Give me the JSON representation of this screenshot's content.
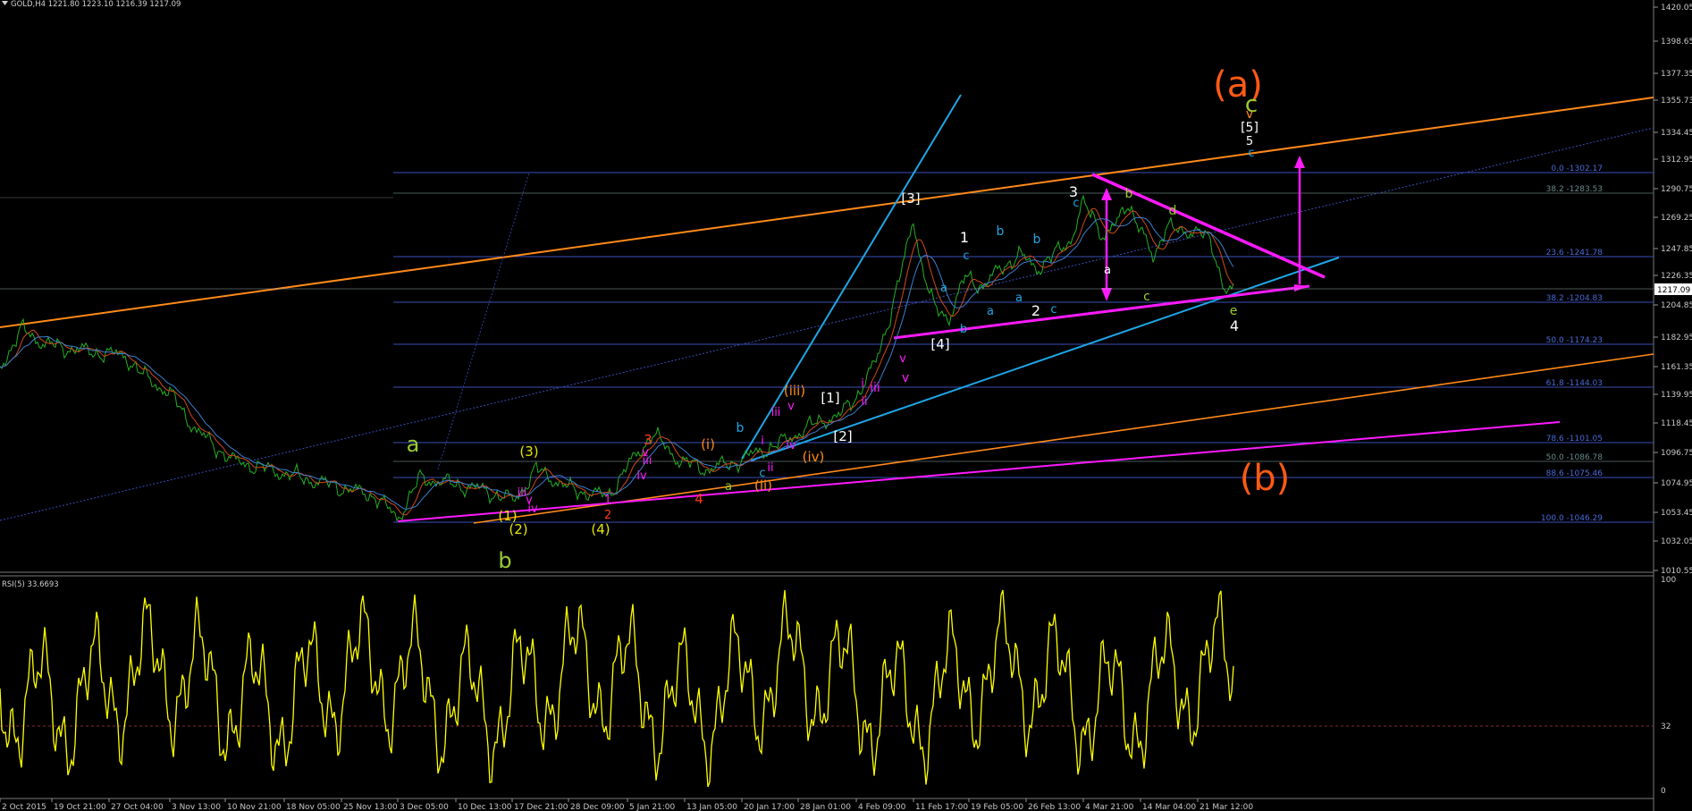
{
  "header": {
    "symbol_line": "GOLD,H4  1221.80 1223.10 1216.39 1217.09",
    "rsi_label": "RSI(5) 33.6693"
  },
  "colors": {
    "background": "#000000",
    "price": "#22b022",
    "ma_fast": "#d04a1a",
    "ma_slow": "#3a7fd0",
    "rsi": "#ffff00",
    "orange_channel": "#ff8a1a",
    "magenta": "#ff1aff",
    "cyan_trend": "#1fa6e6",
    "fib_line": "#3a4fb8"
  },
  "price_axis": {
    "ticks": [
      "1420.05",
      "1398.65",
      "1377.35",
      "1355.73",
      "1334.45",
      "1312.95",
      "1290.75",
      "1269.25",
      "1247.85",
      "1226.35",
      "1204.85",
      "1182.95",
      "1161.35",
      "1139.95",
      "1118.45",
      "1096.75",
      "1074.95",
      "1053.45",
      "1032.05",
      "1010.55"
    ],
    "current_price": "1217.09"
  },
  "rsi_axis": {
    "ticks": [
      "100",
      "32",
      "0"
    ]
  },
  "time_axis": {
    "ticks": [
      "2 Oct 2015",
      "19 Oct 21:00",
      "27 Oct 04:00",
      "3 Nov 13:00",
      "10 Nov 21:00",
      "18 Nov 05:00",
      "25 Nov 13:00",
      "3 Dec 05:00",
      "10 Dec 13:00",
      "17 Dec 21:00",
      "28 Dec 09:00",
      "5 Jan 21:00",
      "13 Jan 05:00",
      "20 Jan 17:00",
      "28 Jan 01:00",
      "4 Feb 09:00",
      "11 Feb 17:00",
      "19 Feb 05:00",
      "26 Feb 13:00",
      "4 Mar 21:00",
      "14 Mar 04:00",
      "21 Mar 12:00"
    ]
  },
  "fib_levels": [
    {
      "label": "0.0 -1302.17"
    },
    {
      "label": "38.2 -1283.53"
    },
    {
      "label": "23.6 -1241.78"
    },
    {
      "label": "38.2 -1204.83"
    },
    {
      "label": "50.0 -1174.23"
    },
    {
      "label": "61.8 -1144.03"
    },
    {
      "label": "78.6 -1101.05"
    },
    {
      "label": "50.0 -1086.78"
    },
    {
      "label": "88.6 -1075.46"
    },
    {
      "label": "100.0 -1046.29"
    }
  ],
  "wave_labels": [
    {
      "text": "(a)",
      "color": "#ff5a14",
      "size": 40
    },
    {
      "text": "c",
      "color": "#9acd32",
      "size": 26
    },
    {
      "text": "v",
      "color": "#ff8a1a",
      "size": 14
    },
    {
      "text": "[5]",
      "color": "#ffffff",
      "size": 14
    },
    {
      "text": "5",
      "color": "#ffffff",
      "size": 13
    },
    {
      "text": "c",
      "color": "#1fa6e6",
      "size": 13
    },
    {
      "text": "(b)",
      "color": "#ff5a14",
      "size": 40
    },
    {
      "text": "a",
      "color": "#9acd32",
      "size": 24
    },
    {
      "text": "b",
      "color": "#9acd32",
      "size": 24
    },
    {
      "text": "(3)",
      "color": "#e6e600",
      "size": 15
    },
    {
      "text": "(1)",
      "color": "#e6e600",
      "size": 15
    },
    {
      "text": "(2)",
      "color": "#e6e600",
      "size": 15
    },
    {
      "text": "(4)",
      "color": "#e6e600",
      "size": 15
    },
    {
      "text": "iii",
      "color": "#ff1aff",
      "size": 13
    },
    {
      "text": "iv",
      "color": "#ff1aff",
      "size": 13
    },
    {
      "text": "v",
      "color": "#ff1aff",
      "size": 13
    },
    {
      "text": "1",
      "color": "#ff1aff",
      "size": 13
    },
    {
      "text": "2",
      "color": "#ff3a1a",
      "size": 13
    },
    {
      "text": "3",
      "color": "#ff3a1a",
      "size": 15
    },
    {
      "text": "4",
      "color": "#ff3a1a",
      "size": 15
    },
    {
      "text": "iii",
      "color": "#ff1aff",
      "size": 13
    },
    {
      "text": "iv",
      "color": "#ff1aff",
      "size": 13
    },
    {
      "text": "v",
      "color": "#ff1aff",
      "size": 13
    },
    {
      "text": "(i)",
      "color": "#ff8a1a",
      "size": 15
    },
    {
      "text": "(ii)",
      "color": "#ff8a1a",
      "size": 15
    },
    {
      "text": "(iii)",
      "color": "#ff8a1a",
      "size": 15
    },
    {
      "text": "(iv)",
      "color": "#ff8a1a",
      "size": 15
    },
    {
      "text": "a",
      "color": "#9acd32",
      "size": 13
    },
    {
      "text": "b",
      "color": "#1fa6e6",
      "size": 14
    },
    {
      "text": "c",
      "color": "#1fa6e6",
      "size": 13
    },
    {
      "text": "i",
      "color": "#ff1aff",
      "size": 13
    },
    {
      "text": "ii",
      "color": "#ff1aff",
      "size": 13
    },
    {
      "text": "iii",
      "color": "#ff1aff",
      "size": 13
    },
    {
      "text": "iv",
      "color": "#ff1aff",
      "size": 13
    },
    {
      "text": "v",
      "color": "#ff1aff",
      "size": 13
    },
    {
      "text": "[1]",
      "color": "#ffffff",
      "size": 15
    },
    {
      "text": "[2]",
      "color": "#ffffff",
      "size": 15
    },
    {
      "text": "i",
      "color": "#ff1aff",
      "size": 13
    },
    {
      "text": "ii",
      "color": "#ff1aff",
      "size": 13
    },
    {
      "text": "iii",
      "color": "#ff1aff",
      "size": 14
    },
    {
      "text": "v",
      "color": "#ff1aff",
      "size": 14
    },
    {
      "text": "[3]",
      "color": "#ffffff",
      "size": 15
    },
    {
      "text": "v",
      "color": "#ff1aff",
      "size": 13
    },
    {
      "text": "[4]",
      "color": "#ffffff",
      "size": 15
    },
    {
      "text": "a",
      "color": "#1fa6e6",
      "size": 13
    },
    {
      "text": "b",
      "color": "#1fa6e6",
      "size": 13
    },
    {
      "text": "1",
      "color": "#ffffff",
      "size": 16
    },
    {
      "text": "c",
      "color": "#1fa6e6",
      "size": 13
    },
    {
      "text": "a",
      "color": "#1fa6e6",
      "size": 13
    },
    {
      "text": "b",
      "color": "#1fa6e6",
      "size": 14
    },
    {
      "text": "a",
      "color": "#1fa6e6",
      "size": 13
    },
    {
      "text": "b",
      "color": "#1fa6e6",
      "size": 14
    },
    {
      "text": "c",
      "color": "#1fa6e6",
      "size": 13
    },
    {
      "text": "2",
      "color": "#ffffff",
      "size": 16
    },
    {
      "text": "3",
      "color": "#ffffff",
      "size": 16
    },
    {
      "text": "c",
      "color": "#1fa6e6",
      "size": 13
    },
    {
      "text": "a",
      "color": "#ffffff",
      "size": 13
    },
    {
      "text": "b",
      "color": "#9acd32",
      "size": 14
    },
    {
      "text": "c",
      "color": "#9acd32",
      "size": 14
    },
    {
      "text": "d",
      "color": "#9acd32",
      "size": 14
    },
    {
      "text": "e",
      "color": "#9acd32",
      "size": 14
    },
    {
      "text": "4",
      "color": "#ffffff",
      "size": 16
    }
  ]
}
